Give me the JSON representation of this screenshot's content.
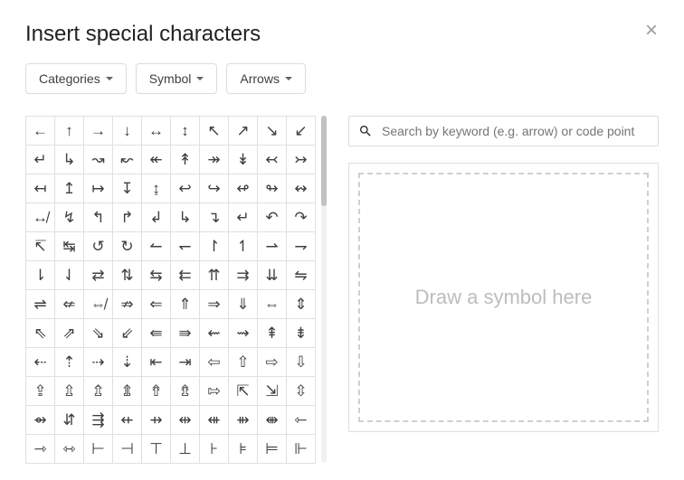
{
  "dialog": {
    "title": "Insert special characters"
  },
  "dropdowns": {
    "categories": "Categories",
    "script": "Symbol",
    "subcategory": "Arrows"
  },
  "search": {
    "placeholder": "Search by keyword (e.g. arrow) or code point"
  },
  "draw": {
    "prompt": "Draw a symbol here"
  },
  "grid": {
    "rows": [
      [
        "←",
        "↑",
        "→",
        "↓",
        "↔",
        "↕",
        "↖",
        "↗",
        "↘",
        "↙"
      ],
      [
        "↵",
        "↳",
        "↝",
        "↜",
        "↞",
        "↟",
        "↠",
        "↡",
        "↢",
        "↣"
      ],
      [
        "↤",
        "↥",
        "↦",
        "↧",
        "↨",
        "↩",
        "↪",
        "↫",
        "↬",
        "↭"
      ],
      [
        "↮",
        "↯",
        "↰",
        "↱",
        "↲",
        "↳",
        "↴",
        "↵",
        "↶",
        "↷"
      ],
      [
        "↸",
        "↹",
        "↺",
        "↻",
        "↼",
        "↽",
        "↾",
        "↿",
        "⇀",
        "⇁"
      ],
      [
        "⇂",
        "⇃",
        "⇄",
        "⇅",
        "⇆",
        "⇇",
        "⇈",
        "⇉",
        "⇊",
        "⇋"
      ],
      [
        "⇌",
        "⇍",
        "⇎",
        "⇏",
        "⇐",
        "⇑",
        "⇒",
        "⇓",
        "⇔",
        "⇕"
      ],
      [
        "⇖",
        "⇗",
        "⇘",
        "⇙",
        "⇚",
        "⇛",
        "⇜",
        "⇝",
        "⇞",
        "⇟"
      ],
      [
        "⇠",
        "⇡",
        "⇢",
        "⇣",
        "⇤",
        "⇥",
        "⇦",
        "⇧",
        "⇨",
        "⇩"
      ],
      [
        "⇪",
        "⇫",
        "⇬",
        "⇭",
        "⇮",
        "⇯",
        "⇰",
        "⇱",
        "⇲",
        "⇳"
      ],
      [
        "⇴",
        "⇵",
        "⇶",
        "⇷",
        "⇸",
        "⇹",
        "⇺",
        "⇻",
        "⇼",
        "⇽"
      ],
      [
        "⇾",
        "⇿",
        "⊢",
        "⊣",
        "⊤",
        "⊥",
        "⊦",
        "⊧",
        "⊨",
        "⊩"
      ]
    ]
  }
}
